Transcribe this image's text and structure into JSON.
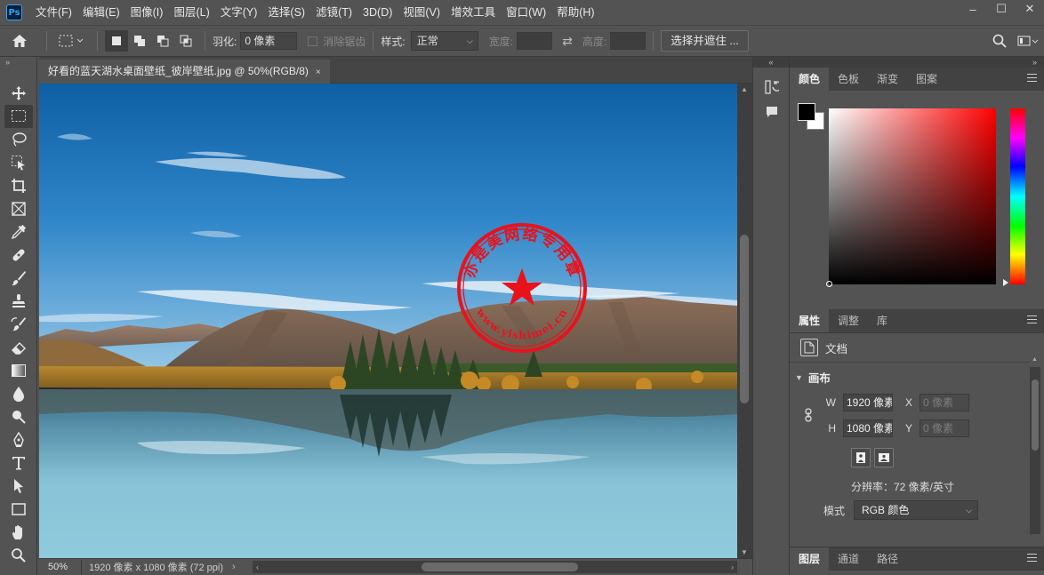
{
  "app": {
    "logo": "Ps"
  },
  "menu": [
    "文件(F)",
    "编辑(E)",
    "图像(I)",
    "图层(L)",
    "文字(Y)",
    "选择(S)",
    "滤镜(T)",
    "3D(D)",
    "视图(V)",
    "增效工具",
    "窗口(W)",
    "帮助(H)"
  ],
  "window_controls": {
    "minimize": "–",
    "maximize": "☐",
    "close": "✕"
  },
  "options_bar": {
    "feather_label": "羽化:",
    "feather_value": "0 像素",
    "antialias_label": "消除锯齿",
    "style_label": "样式:",
    "style_value": "正常",
    "width_label": "宽度:",
    "height_label": "高度:",
    "select_mask_button": "选择并遮住 ..."
  },
  "document": {
    "tab_title": "好看的蓝天湖水桌面壁纸_彼岸壁纸.jpg @ 50%(RGB/8)",
    "tab_close": "×",
    "zoom": "50%",
    "info": "1920 像素 x 1080 像素 (72 ppi)",
    "stamp_text_top": "亦是美网络专用章",
    "stamp_text_bottom": "www.yishimei.cn"
  },
  "color_panel": {
    "tabs": [
      "颜色",
      "色板",
      "渐变",
      "图案"
    ],
    "foreground": "#000000",
    "background": "#ffffff"
  },
  "properties_panel": {
    "tabs": [
      "属性",
      "调整",
      "库"
    ],
    "doc_label": "文档",
    "canvas_section": "画布",
    "w_label": "W",
    "w_value": "1920 像素",
    "h_label": "H",
    "h_value": "1080 像素",
    "x_label": "X",
    "x_value": "0 像素",
    "y_label": "Y",
    "y_value": "0 像素",
    "resolution": "分辨率：72 像素/英寸",
    "mode_label": "模式",
    "mode_value": "RGB 颜色"
  },
  "layers_panel": {
    "tabs": [
      "图层",
      "通道",
      "路径"
    ]
  },
  "colors": {
    "accent": "#31a8ff",
    "ui_bg": "#535353",
    "stamp_red": "#e8121c"
  }
}
